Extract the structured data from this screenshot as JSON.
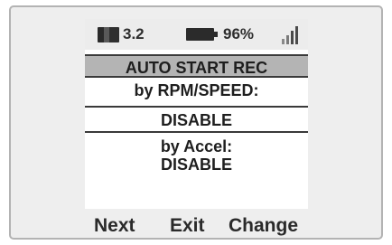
{
  "status": {
    "memory_value": "3.2",
    "battery_value": "96%"
  },
  "menu": {
    "title": "AUTO START REC",
    "rpm_label": "by RPM/SPEED:",
    "rpm_value": "DISABLE",
    "accel_label": "by Accel:",
    "accel_value": "DISABLE"
  },
  "softkeys": {
    "left": "Next",
    "center": "Exit",
    "right": "Change"
  },
  "icons": {
    "memory": "memory-card-icon",
    "battery": "battery-icon",
    "signal": "signal-strength-icon"
  }
}
